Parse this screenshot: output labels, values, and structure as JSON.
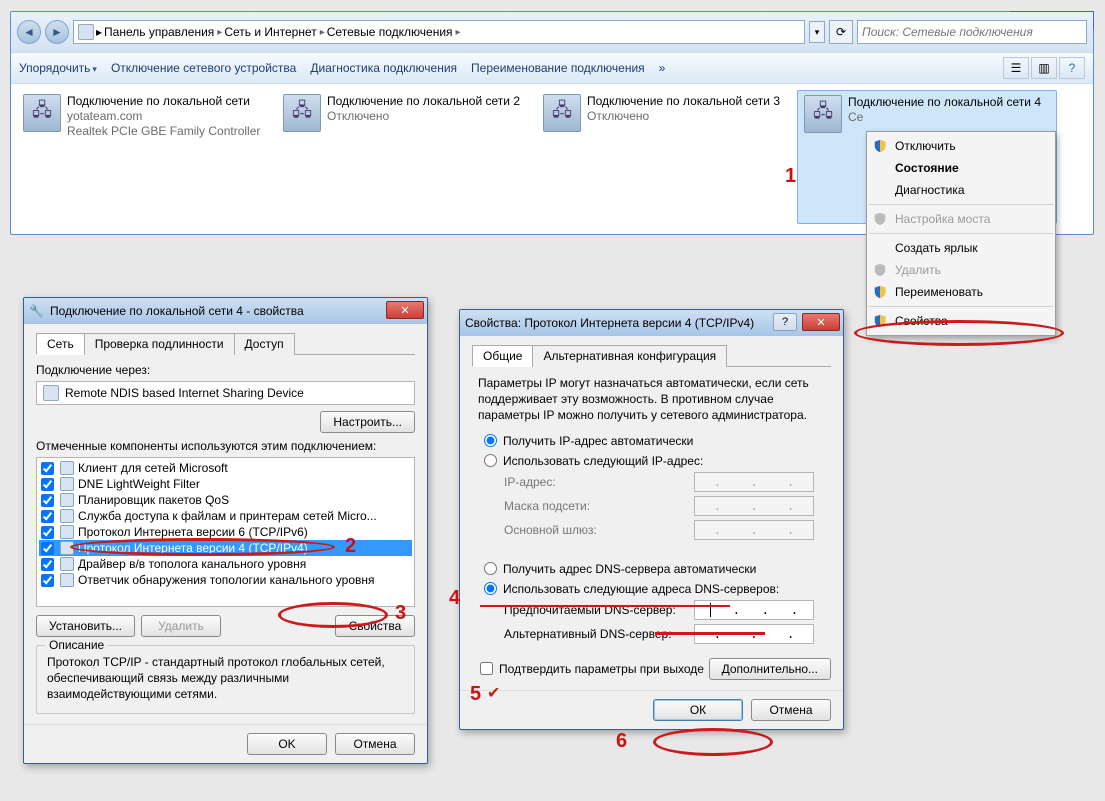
{
  "explorer": {
    "breadcrumb": [
      "Панель управления",
      "Сеть и Интернет",
      "Сетевые подключения"
    ],
    "search_placeholder": "Поиск: Сетевые подключения",
    "toolbar": {
      "organize": "Упорядочить",
      "disable": "Отключение сетевого устройства",
      "diagnose": "Диагностика подключения",
      "rename": "Переименование подключения"
    },
    "connections": [
      {
        "title": "Подключение по локальной сети",
        "line2": "yotateam.com",
        "line3": "Realtek PCIe GBE Family Controller"
      },
      {
        "title": "Подключение по локальной сети 2",
        "line2": "Отключено",
        "line3": ""
      },
      {
        "title": "Подключение по локальной сети 3",
        "line2": "Отключено",
        "line3": ""
      },
      {
        "title": "Подключение по локальной сети 4",
        "line2": "Се",
        "line3": ""
      }
    ]
  },
  "context_menu": {
    "items": {
      "disable": "Отключить",
      "status": "Состояние",
      "diagnose": "Диагностика",
      "bridge": "Настройка моста",
      "shortcut": "Создать ярлык",
      "delete": "Удалить",
      "rename": "Переименовать",
      "properties": "Свойства"
    }
  },
  "dialog1": {
    "title": "Подключение по локальной сети 4 - свойства",
    "tabs": {
      "net": "Сеть",
      "auth": "Проверка подлинности",
      "access": "Доступ"
    },
    "connect_via_label": "Подключение через:",
    "adapter": "Remote NDIS based Internet Sharing Device",
    "configure": "Настроить...",
    "components_label": "Отмеченные компоненты используются этим подключением:",
    "components": [
      "Клиент для сетей Microsoft",
      "DNE LightWeight Filter",
      "Планировщик пакетов QoS",
      "Служба доступа к файлам и принтерам сетей Micro...",
      "Протокол Интернета версии 6 (TCP/IPv6)",
      "Протокол Интернета версии 4 (TCP/IPv4)",
      "Драйвер в/в тополога канального уровня",
      "Ответчик обнаружения топологии канального уровня"
    ],
    "buttons": {
      "install": "Установить...",
      "remove": "Удалить",
      "properties": "Свойства"
    },
    "description_label": "Описание",
    "description": "Протокол TCP/IP - стандартный протокол глобальных сетей, обеспечивающий связь между различными взаимодействующими сетями.",
    "ok": "OK",
    "cancel": "Отмена"
  },
  "dialog2": {
    "title": "Свойства: Протокол Интернета версии 4 (TCP/IPv4)",
    "tabs": {
      "general": "Общие",
      "alt": "Альтернативная конфигурация"
    },
    "intro": "Параметры IP могут назначаться автоматически, если сеть поддерживает эту возможность. В противном случае параметры IP можно получить у сетевого администратора.",
    "radio_ip_auto": "Получить IP-адрес автоматически",
    "radio_ip_manual": "Использовать следующий IP-адрес:",
    "ip_label": "IP-адрес:",
    "mask_label": "Маска подсети:",
    "gateway_label": "Основной шлюз:",
    "radio_dns_auto": "Получить адрес DNS-сервера автоматически",
    "radio_dns_manual": "Использовать следующие адреса DNS-серверов:",
    "dns1_label": "Предпочитаемый DNS-сервер:",
    "dns2_label": "Альтернативный DNS-сервер:",
    "confirm": "Подтвердить параметры при выходе",
    "advanced": "Дополнительно...",
    "ok": "ОК",
    "cancel": "Отмена"
  },
  "annotations": {
    "n1": "1",
    "n2": "2",
    "n3": "3",
    "n4": "4",
    "n5": "5",
    "n6": "6"
  }
}
